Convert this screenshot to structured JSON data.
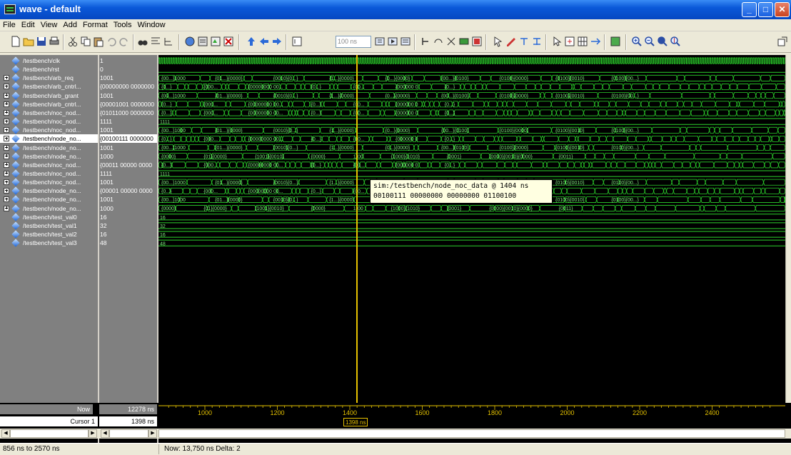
{
  "window": {
    "title": "wave - default"
  },
  "menu": [
    "File",
    "Edit",
    "View",
    "Add",
    "Format",
    "Tools",
    "Window"
  ],
  "toolbar": {
    "time_entry": "100 ns"
  },
  "signals": [
    {
      "name": "/testbench/clk",
      "value": "1",
      "kind": "clock",
      "expandable": false
    },
    {
      "name": "/testbench/rst",
      "value": "0",
      "kind": "low",
      "expandable": false
    },
    {
      "name": "/testbench/arb_req",
      "value": "1001",
      "kind": "bus",
      "expandable": true
    },
    {
      "name": "/testbench/arb_cntrl...",
      "value": "{00000000 0000000",
      "kind": "busdense",
      "expandable": true
    },
    {
      "name": "/testbench/arb_grant",
      "value": "1001",
      "kind": "bus",
      "expandable": true
    },
    {
      "name": "/testbench/arb_cntrl...",
      "value": "{00001001 0000000",
      "kind": "busdense",
      "expandable": true
    },
    {
      "name": "/testbench/noc_nod...",
      "value": "{01011000 0000000",
      "kind": "busdense",
      "expandable": true
    },
    {
      "name": "/testbench/noc_nod...",
      "value": "1111",
      "kind": "const",
      "expandable": true
    },
    {
      "name": "/testbench/noc_nod...",
      "value": "1001",
      "kind": "bus",
      "expandable": true
    },
    {
      "name": "/testbench/node_no...",
      "value": "{00100111 0000000",
      "kind": "busdense",
      "expandable": true,
      "selected": true
    },
    {
      "name": "/testbench/node_no...",
      "value": "1001",
      "kind": "bus",
      "expandable": true
    },
    {
      "name": "/testbench/node_no...",
      "value": "1000",
      "kind": "bus2",
      "expandable": true
    },
    {
      "name": "/testbench/noc_nod...",
      "value": "{00011 00000 0000",
      "kind": "busdense",
      "expandable": true
    },
    {
      "name": "/testbench/noc_nod...",
      "value": "1111",
      "kind": "const",
      "expandable": true
    },
    {
      "name": "/testbench/noc_nod...",
      "value": "1001",
      "kind": "bus",
      "expandable": true
    },
    {
      "name": "/testbench/node_no...",
      "value": "{00001 00000 0000",
      "kind": "busdense",
      "expandable": true
    },
    {
      "name": "/testbench/node_no...",
      "value": "1001",
      "kind": "bus",
      "expandable": true
    },
    {
      "name": "/testbench/node_no...",
      "value": "1000",
      "kind": "bus2",
      "expandable": true
    },
    {
      "name": "/testbench/test_val0",
      "value": "16",
      "kind": "const",
      "expandable": false
    },
    {
      "name": "/testbench/test_val1",
      "value": "32",
      "kind": "const",
      "expandable": false
    },
    {
      "name": "/testbench/test_val2",
      "value": "16",
      "kind": "const",
      "expandable": false
    },
    {
      "name": "/testbench/test_val3",
      "value": "48",
      "kind": "const",
      "expandable": false
    }
  ],
  "bus_labels": {
    "bus": [
      "{00...}1000",
      "{01...}{0000}",
      "{0010}{0...}",
      "{1...}{0000}",
      "{0...}{0000}",
      "{00...}{0100}",
      "{0100}{0000}",
      "{0100}{0010}",
      "{0100}{00...}"
    ],
    "bus2": [
      "{0000}",
      "{01}{0000}",
      "{1001}{0010}",
      "{0000}",
      "1{00",
      "{1000}{1010}",
      "{0001}",
      "{0000}{0010}{0000}",
      "{0011}"
    ],
    "busdense": [
      "{0...}",
      "{000...",
      "{00000000 00...",
      "{0...}",
      "{00...",
      "{000000 0",
      "{0...}"
    ]
  },
  "tooltip": {
    "line1": "sim:/testbench/node_noc_data @ 1404 ns",
    "line2": "00100111 00000000 00000000 01100100"
  },
  "timeline": {
    "now_label": "Now",
    "now_value": "12278 ns",
    "cursor_label": "Cursor 1",
    "cursor_value": "1398 ns",
    "cursor_tag": "1398 ns",
    "ticks": [
      "1000",
      "1200",
      "1400",
      "1600",
      "1800",
      "2000",
      "2200",
      "2400"
    ]
  },
  "status": {
    "range": "856 ns to 2570 ns",
    "now": "Now: 13,750 ns  Delta: 2"
  },
  "colors": {
    "wave": "#2cd42c",
    "cursor": "#e8c300",
    "titlebar": "#0a58d8"
  }
}
